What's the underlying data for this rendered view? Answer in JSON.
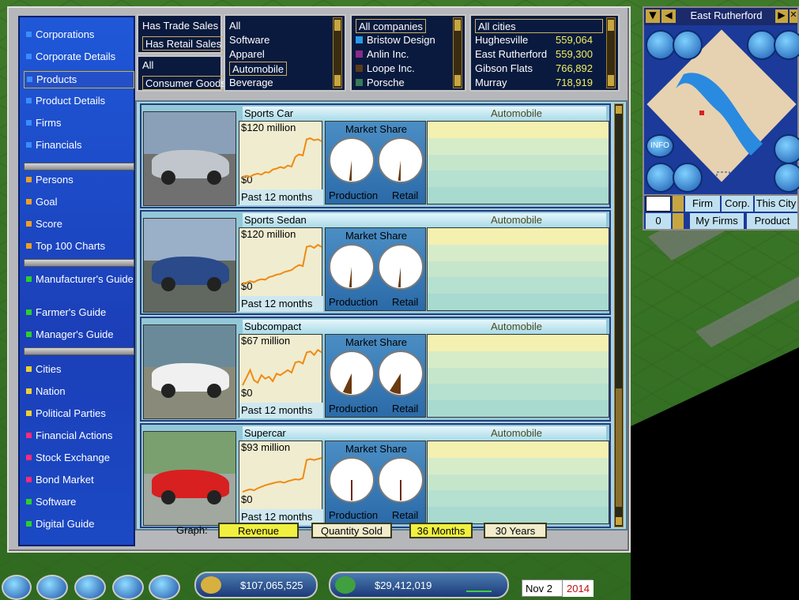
{
  "sidebar": {
    "items": [
      {
        "label": "Corporations",
        "color": "#3a8cff"
      },
      {
        "label": "Corporate Details",
        "color": "#3a8cff"
      },
      {
        "label": "Products",
        "color": "#3a8cff"
      },
      {
        "label": "Product Details",
        "color": "#3a8cff"
      },
      {
        "label": "Firms",
        "color": "#3a8cff"
      },
      {
        "label": "Financials",
        "color": "#3a8cff"
      },
      {
        "label": "Persons",
        "color": "#f2a020"
      },
      {
        "label": "Goal",
        "color": "#f2a020"
      },
      {
        "label": "Score",
        "color": "#f2a020"
      },
      {
        "label": "Top 100 Charts",
        "color": "#f2a020"
      },
      {
        "label": "Manufacturer's Guide",
        "color": "#2bd02b"
      },
      {
        "label": "Farmer's Guide",
        "color": "#2bd02b"
      },
      {
        "label": "Manager's Guide",
        "color": "#2bd02b"
      },
      {
        "label": "Cities",
        "color": "#f0d030"
      },
      {
        "label": "Nation",
        "color": "#f0d030"
      },
      {
        "label": "Political Parties",
        "color": "#f0d030"
      },
      {
        "label": "Financial Actions",
        "color": "#ff2a7a"
      },
      {
        "label": "Stock Exchange",
        "color": "#ff2a7a"
      },
      {
        "label": "Bond Market",
        "color": "#ff2a7a"
      },
      {
        "label": "Software",
        "color": "#2bd02b"
      },
      {
        "label": "Digital Guide",
        "color": "#2bd02b"
      }
    ]
  },
  "filters": {
    "sales": [
      "Has Trade Sales",
      "Has Retail Sales"
    ],
    "class": [
      "All",
      "Consumer Goods"
    ],
    "categories": [
      "All",
      "Software",
      "Apparel",
      "Automobile",
      "Beverage"
    ],
    "companies": [
      {
        "name": "All companies",
        "color": ""
      },
      {
        "name": "Bristow Design",
        "color": "#2a9ae8"
      },
      {
        "name": "Anlin Inc.",
        "color": "#8a2a8a"
      },
      {
        "name": "Loope Inc.",
        "color": "#5a3a1a"
      },
      {
        "name": "Porsche",
        "color": "#3a7a5a"
      }
    ],
    "cities": [
      {
        "name": "All cities",
        "pop": ""
      },
      {
        "name": "Hughesville",
        "pop": "559,064"
      },
      {
        "name": "East Rutherford",
        "pop": "559,300"
      },
      {
        "name": "Gibson Flats",
        "pop": "766,892"
      },
      {
        "name": "Murray",
        "pop": "718,919"
      }
    ]
  },
  "products": [
    {
      "name": "Sports Car",
      "type": "Automobile",
      "max": "$120 million",
      "zero": "$0",
      "period": "Past 12 months",
      "ms_title": "Market Share",
      "prod_label": "Production",
      "retail_label": "Retail",
      "photo": "silver",
      "share_prod": 0.02,
      "share_retail": 0.02,
      "trend": [
        0.15,
        0.18,
        0.16,
        0.2,
        0.22,
        0.2,
        0.25,
        0.24,
        0.3,
        0.32,
        0.35,
        0.33,
        0.38,
        0.36,
        0.55,
        0.6,
        0.58,
        0.9,
        0.92,
        0.88,
        0.9,
        0.86
      ]
    },
    {
      "name": "Sports Sedan",
      "type": "Automobile",
      "max": "$120 million",
      "zero": "$0",
      "period": "Past 12 months",
      "ms_title": "Market Share",
      "prod_label": "Production",
      "retail_label": "Retail",
      "photo": "blue",
      "share_prod": 0.02,
      "share_retail": 0.02,
      "trend": [
        0.15,
        0.17,
        0.2,
        0.18,
        0.22,
        0.24,
        0.23,
        0.28,
        0.3,
        0.33,
        0.34,
        0.38,
        0.4,
        0.42,
        0.48,
        0.52,
        0.5,
        0.88,
        0.9,
        0.86,
        0.92,
        0.88
      ]
    },
    {
      "name": "Subcompact",
      "type": "Automobile",
      "max": "$67 million",
      "zero": "$0",
      "period": "Past 12 months",
      "ms_title": "Market Share",
      "prod_label": "Production",
      "retail_label": "Retail",
      "photo": "white",
      "share_prod": 0.07,
      "share_retail": 0.09,
      "trend": [
        0.25,
        0.4,
        0.55,
        0.35,
        0.3,
        0.45,
        0.38,
        0.42,
        0.33,
        0.48,
        0.45,
        0.5,
        0.55,
        0.5,
        0.7,
        0.72,
        0.68,
        0.9,
        0.92,
        0.85,
        0.95,
        0.9
      ]
    },
    {
      "name": "Supercar",
      "type": "Automobile",
      "max": "$93 million",
      "zero": "$0",
      "period": "Past 12 months",
      "ms_title": "Market Share",
      "prod_label": "Production",
      "retail_label": "Retail",
      "photo": "red",
      "share_prod": 0.0,
      "share_retail": 0.0,
      "trend": [
        0.25,
        0.28,
        0.3,
        0.28,
        0.32,
        0.35,
        0.38,
        0.4,
        0.42,
        0.44,
        0.45,
        0.43,
        0.46,
        0.48,
        0.5,
        0.49,
        0.52,
        0.88,
        0.9,
        0.88,
        0.9,
        0.92
      ]
    }
  ],
  "graph_bar": {
    "label": "Graph:",
    "buttons": [
      "Revenue",
      "Quantity Sold",
      "36 Months",
      "30 Years"
    ]
  },
  "map": {
    "city": "East Rutherford",
    "info": "INFO",
    "tabs_top": [
      "Firm",
      "Corp.",
      "This City"
    ],
    "tabs_bottom": [
      "My Firms",
      "Product"
    ],
    "count": "0"
  },
  "status": {
    "cash": "$107,065,525",
    "profit": "$29,412,019",
    "date": "Nov 2",
    "year": "2014"
  }
}
